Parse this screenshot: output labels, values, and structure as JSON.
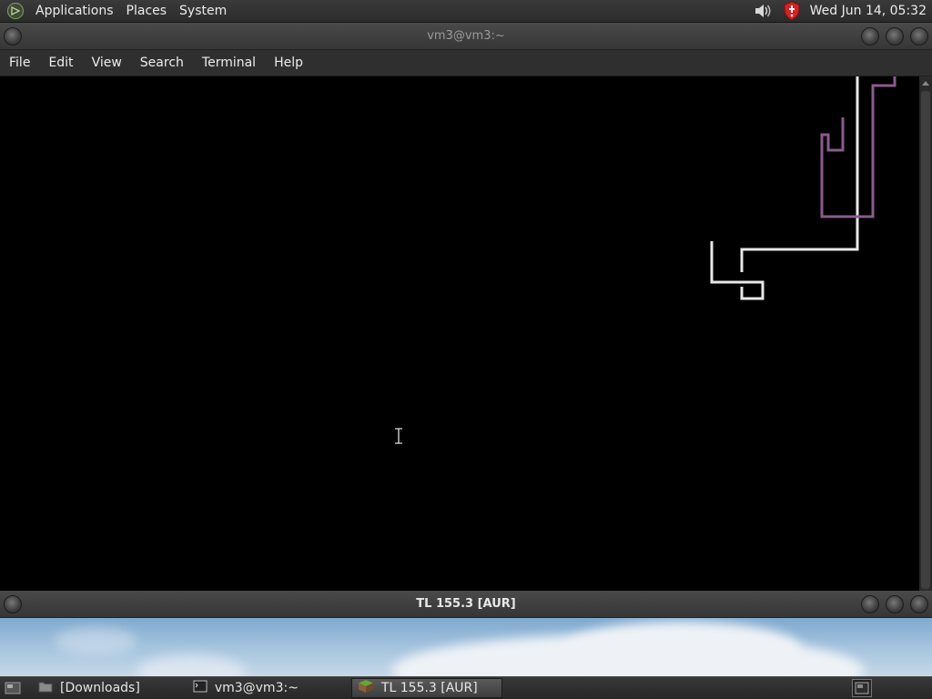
{
  "top_panel": {
    "menus": [
      "Applications",
      "Places",
      "System"
    ],
    "tray_icons": [
      "volume-icon",
      "shield-icon"
    ],
    "clock": "Wed Jun 14, 05:32"
  },
  "terminal_window": {
    "title": "vm3@vm3:~",
    "menubar": [
      "File",
      "Edit",
      "View",
      "Search",
      "Terminal",
      "Help"
    ],
    "background": "#000000",
    "trail_colors": {
      "white": "#e8e8e8",
      "purple": "#8a5a8e"
    }
  },
  "game_window": {
    "title": "TL 155.3 [AUR]"
  },
  "taskbar": {
    "tasks": [
      {
        "label": "[Downloads]",
        "icon": "folder-icon",
        "active": false
      },
      {
        "label": "vm3@vm3:~",
        "icon": "terminal-icon",
        "active": false
      },
      {
        "label": "TL 155.3 [AUR]",
        "icon": "grass-block-icon",
        "active": true
      }
    ]
  }
}
